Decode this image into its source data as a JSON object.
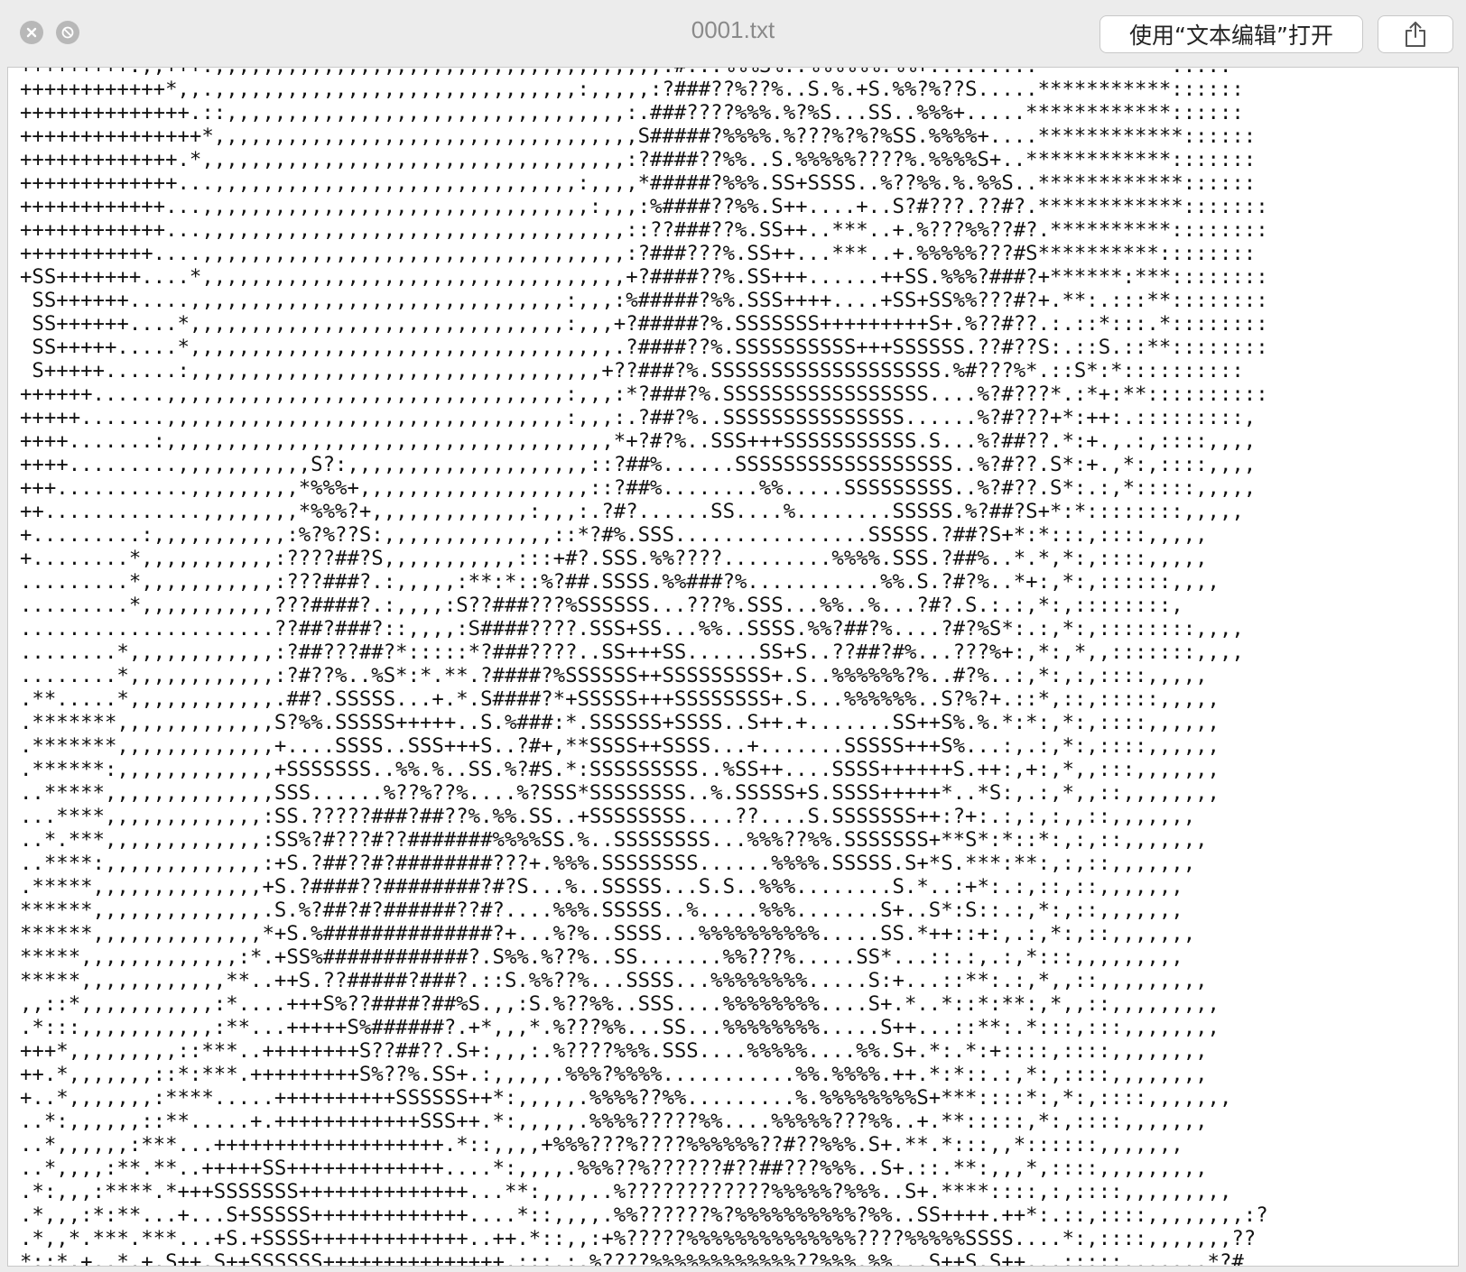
{
  "window": {
    "title": "0001.txt",
    "open_button_label": "使用“文本编辑”打开",
    "close_icon": "close-icon",
    "minimize_icon": "minimize-icon",
    "share_icon": "share-icon"
  },
  "file": {
    "content": "+++++++++.,,+++.,,,,,,,,,,,,,,,,,,,,,,,,,,,,,,,,,,,,,:#:::%%%S%..%%%%%%:%%+.........***********.....\n++++++++++++*,,.,,,,,,,,,,,,,,,,,,,,,,,,,,,,,,:,,,,,:?###??%??%..S.%.+S.%%?%??S.....***********::::::\n++++++++++++++.::,,,,,,,,,,,,,,,,,,,,,,,,,,,,,,,,,:.###????%%%.%?%S...SS..%%%+.....************::::::\n+++++++++++++++*,,,,,,,,,,,,,,,,,,,,,,,,,,,,,,,,,,,S#####?%%%%.%???%?%?%SS.%%%%+....************::::::\n+++++++++++++.*,,,,,,,,,,,,,,,,,,,,,,,,,,,,,,,,,,,:?####??%%..S.%%%%%????%.%%%%S+..************:::::::\n+++++++++++++...,,,,,,,,,,,,,,,,,,,,,,,,,,,,,,:,,,,*#####?%%%.SS+SSSS..%??%%.%.%%S..************::::::\n++++++++++++...,,,,,,,,,,,,,,,,,,,,,,,,,,,,,,,,:,,,:%####??%%.S++....+..S?#???.??#?.************:::::::\n++++++++++++...,,,,,,,,,,,,,,,,,,,,,,,,,,,,,,,,,,,::??###??%.SS++..***..+.%???%%??#?.**********::::::::\n+++++++++++....,,,,,,,,,,,,,,,,,,,,,,,,,,,,,,,,,,,:?###???%.SS++...***..+.%%%%%???#S**********::::::::\n+SS+++++++....*,,,,,,,,,,,,,,,,,,,,,,,,,,,,,,,,,,,+?####??%.SS+++......++SS.%%%?###?+******:***::::::::\n SS++++++.....,,,,,,,,,,,,,,,,,,,,,,,,,,,,,,,:,,,:%#####?%%.SSS++++....+SS+SS%%???#?+.**:.:::**::::::::\n SS++++++....*,,,,,,,,,,,,,,,,,,,,,,,,,,,,,,,:,,,+?#####?%.SSSSSSS+++++++++S+.%??#??.:.::*:::.*::::::::\n SS+++++.....*,,,,,,,,,,,,,,,,,,,,,,,,,,,,,,,,,,,.?####??%.SSSSSSSSSS+++SSSSSS.??#??S:.::S.::**::::::::\n S+++++......:,,,,,,,,,,,,,,,,,,,,,,,,,,,,,,,,,,+??###?%.SSSSSSSSSSSSSSSSSSS.%#???%*.::S*:*::::::::::\n++++++......,,,,,,,,,,,,,,,,,,,,,,,,,,,,,,,,,:,,,:*?###?%.SSSSSSSSSSSSSSSSS....%?#???*.:*+:**::::::::::\n+++++.......,,,,,,,,,,,,,,,,,,,,,,,,,,,,,,,,,:,,,:.?##?%..SSSSSSSSSSSSSSS......%?#???+*:++:.:::::::::,\n++++.......:,,,,,,,,,,,,,,,,,,,,,,,,,,,,,,,,,,,,,*+?#?%..SSS+++SSSSSSSSSSS.S...%?##??.*:+.,.:,::::,,,,\n++++.........,,,,,,,,,,,S?:,,,,,,,,,,,,,,,,,,,,::?##%......SSSSSSSSSSSSSSSSSS..%?#??.S*:+.,*:,::::,,,,\n+++...........,,,,,,,,,*%%%+,,,,,,,,,,,,,,,,,,,::?##%........%%.....SSSSSSSSS..%?#??.S*:.:,*:::::,,,,,\n++.............,,,,,,,,*%%%?+,,,,,,,,,,,,,:,,,:.?#?......SS....%........SSSSS.%?##?S+*:*::::::::,,,,,\n+.........:,,,,,,,,,,,:%?%??S:,,,,,,,,,,,,,,::*?#%.SSS................SSSSS.?##?S+*:*:::,::::,,,,,\n+........*,,,,,,,,,,,:????##?S,,,,,,,,,,,:::+#?.SSS.%%????.........%%%%.SSS.?##%..*.*,*:,::::,,,,,\n.........*,,,,,,,,,,,:???###?.:,,,,,:**:*::%?##.SSSS.%%###?%...........%%.S.?#?%..*+:,*:,::::::,,,,\n.........*,,,,,,,,,,,???####?.:,,,,:S??###???%SSSSSS...???%.SSS...%%..%...?#?.S.:.:,*:,::::::::,\n.....................??##?###?::,,,,:S####????.SSS+SS...%%..SSSS.%%?##?%....?#?%S*:.:,*:,::::::::,,,,\n........*,,,,,,,,,,,,:?##???##?*:::::*?###????..SS+++SS......SS+S..??##?#%...???%+:,*:,*,,:::::::,,,,\n........*,,,,,,,,,,,,:?#??%..%S*:*.**.?####?%SSSSSS++SSSSSSSSS+.S..%%%%%%?%..#?%..:,*:,:,::::,,,,,\n.**.....*,,,,,,,,,,,,.##?.SSSSS...+.*.S####?*+SSSSS+++SSSSSSSS+.S...%%%%%%..S?%?+.::*,::,:::::,,,,,\n.*******,,,,,,,,,,,,,S?%%.SSSSS+++++..S.%###:*.SSSSSS+SSSS..S++.+.......SS++S%.%.*:*:,*:,::::,,,,,,\n.*******,,,,,,,,,,,,,+....SSSS..SSS+++S..?#+,**SSSS++SSSS...+.......SSSSS+++S%...:,.:,*:,::::,,,,,,\n.******:,,,,,,,,,,,,,+SSSSSSS..%%.%..SS.%?#S.*:SSSSSSSSS..%SS++....SSSS++++++S.++:,+:,*,,:::,,,,,,,\n..*****,,,,,,,,,,,,,,SSS......%??%??%....%?SSS*SSSSSSSS..%.SSSSS+S.SSSS+++++*..*S:,.:,*,,::,,,,,,,,\n...****,,,,,,,,,,,,,:SS.?????###?##??%.%%.SS..+SSSSSSSS....??....S.SSSSSSS++:?+:.:,:,:,,::,,,,,,,\n..*.***,,,,,,,,,,,,,:SS%?#???#??#######%%%%SS.%..SSSSSSSS...%%%??%%.SSSSSSS+**S*:*::*:,:,::,,,,,,,\n..****:,,,,,,,,,,,,,:+S.?##??#?########???+.%%%.SSSSSSSS......%%%%.SSSSS.S+*S.***:**:,:,::,,,,,,,\n.*****,,,,,,,,,,,,,,+S.?####??########?#?S...%..SSSSS...S.S..%%%........S.*..:+*:.:,::,::,,,,,,,\n******,,,,,,,,,,,,,,.S.%?##?#?######??#?....%%%.SSSSS..%.....%%%.......S+..S*:S::.:,*:,::,,,,,,,\n******,,,,,,,,,,,,,,*+S.%##############?+...%?%..SSSS...%%%%%%%%%%.....SS.*++::+:,.:,*:,::,,,,,,,\n*****,,,,,,,,,,,,,:*.+SS%############?.S%%.%??%..SS.......%%???%.....SS*...::.:,.:,*:::,,,,,,,,,\n*****,,,,,,,,,,,,**..++S.??#####?###?.::S.%%??%...SSSS...%%%%%%%%.....S:+...::**:.:,*,,::,,,,,,,,,\n,,::*,,,,,,,,,,,:*....+++S%??####?##%S.,,:S.%??%%..SSS....%%%%%%%%....S+.*..*::*:**:,*,,::,,,,,,,,,\n.*:::,,,,,,,,,,,:**...+++++S%######?.+*,,,*.%???%%...SS...%%%%%%%%.....S++...::**:.*:::,:::,,,,,,,,\n+++*,,,,,,,,,::***..++++++++S??##??.S+:,,,:.%????%%%.SSS....%%%%%....%%.S+.*:.*:+::::,::::,,,,,,,,\n++.*,,,,,,,::*:***.+++++++++S%??%.SS+.:,,,,,.%%%?%%%%...........%%.%%%%.++.*:*::.:,*:,::::,,,,,,,,\n+..*,,,,,,,:****.....++++++++++SSSSSS++*:,,,,,.%%%%??%%.........%.%%%%%%%%S+***::::*:,*:,::::,,,,,,,\n..*:,,,,,,::**.....+.++++++++++++SSS++.*:,,,,,.%%%%?????%%....%%%%%???%%..+.**:::::,*:,::::,,,,,,,\n..*,,,,,,:***...+++++++++++++++++++.*::,,,,+%%%???%????%%%%%%??#??%%%.S+.**.*:::,,*::::::,,,,,,,\n..*,,,,:**.**..+++++SS+++++++++++++....*:,,,,.%%%??%??????#??##???%%%..S+.::.**:,,,*,::::,,,,,,,,,\n.*:,,,:****.*+++SSSSSSS++++++++++++++...**:,,,,..%????????????%%%%%?%%%..S+.****::::,:,::::,,,,,,,,,\n.*,,,:*:**...+...S+SSSSS+++++++++++++....*::,,,,.%%??????%?%%%%%%%%%%?%%..SS++++.++*:.::,::::,,,,,,,,:?\n.*,,*.***.***...+S.+SSSS+++++++++++++..++.*::,,:+%?????%%%%%%%%%%%%%%????%%%%%SSSS....*:,::::,,,,,,,??\n*::*.+..*.+.S++.S++SSSSSS+++++++++++++++.:::.:.%????%%%%%%%%%%%%??%%%.%%...S++S.S++...:::::.......*?#"
  }
}
